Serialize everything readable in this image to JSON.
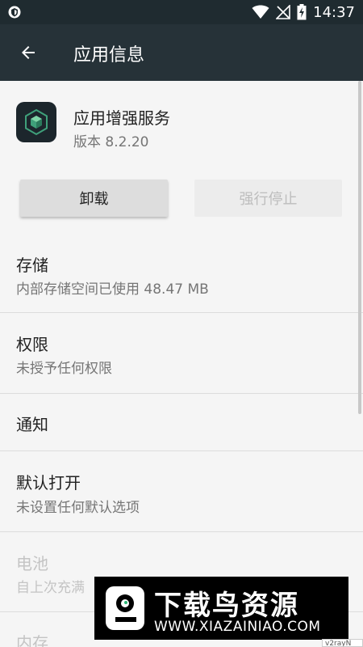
{
  "status_bar": {
    "time": "14:37",
    "icons": [
      "shield-icon",
      "wifi-icon",
      "no-sim-icon",
      "battery-charging-icon"
    ]
  },
  "toolbar": {
    "title": "应用信息",
    "back_icon": "arrow-back-icon"
  },
  "app": {
    "name": "应用增强服务",
    "version": "版本 8.2.20"
  },
  "buttons": {
    "uninstall": "卸载",
    "force_stop": "强行停止"
  },
  "settings": [
    {
      "title": "存储",
      "subtitle": "内部存储空间已使用 48.47 MB",
      "enabled": true
    },
    {
      "title": "权限",
      "subtitle": "未授予任何权限",
      "enabled": true
    },
    {
      "title": "通知",
      "subtitle": "",
      "enabled": true
    },
    {
      "title": "默认打开",
      "subtitle": "未设置任何默认选项",
      "enabled": true
    },
    {
      "title": "电池",
      "subtitle": "自上次充满",
      "enabled": false
    },
    {
      "title": "内存",
      "subtitle": "",
      "enabled": false
    }
  ],
  "watermark": {
    "title": "下载鸟资源",
    "url": "WWW.XIAZAINIAO.COM"
  },
  "corner_tag": "v2rayN"
}
